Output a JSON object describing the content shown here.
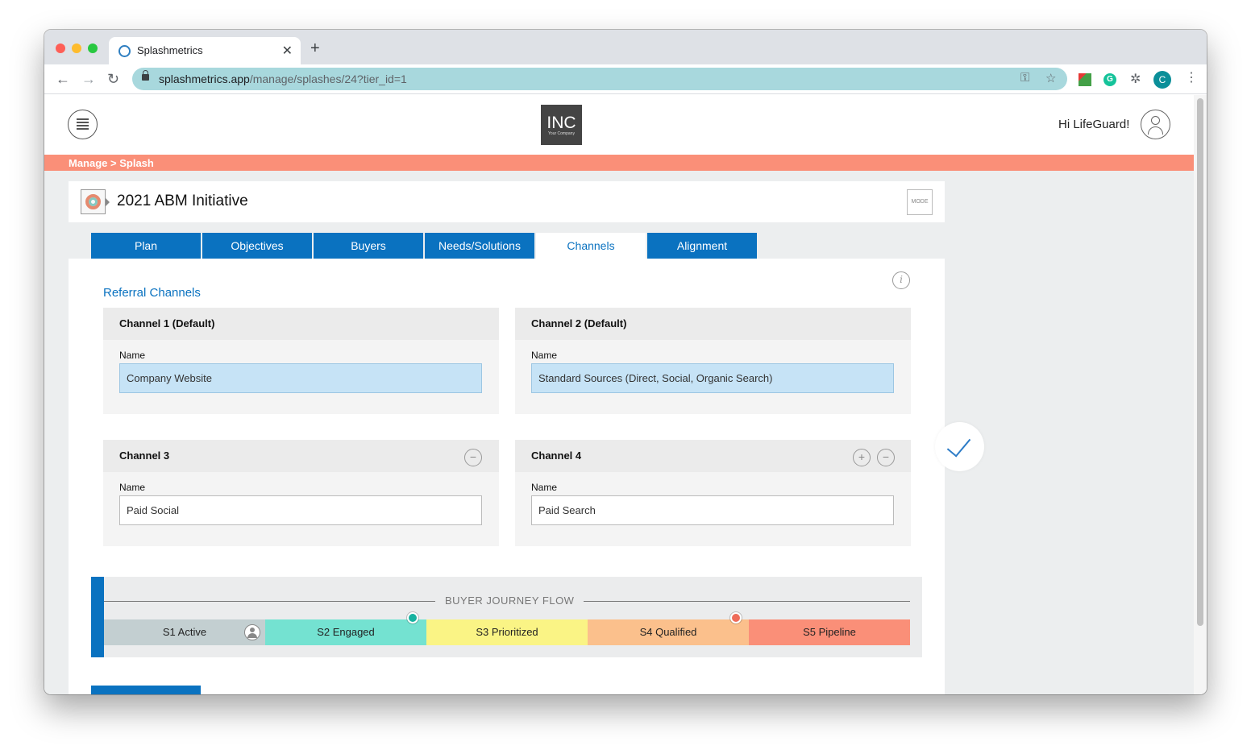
{
  "browser": {
    "tab_title": "Splashmetrics",
    "tab_close": "✕",
    "new_tab": "+",
    "url_domain": "splashmetrics.app",
    "url_path": "/manage/splashes/24?tier_id=1",
    "profile_initial": "C"
  },
  "header": {
    "logo_main": "INC",
    "logo_sub": "Your Company",
    "greeting": "Hi LifeGuard!"
  },
  "breadcrumb": "Manage > Splash",
  "initiative": {
    "title": "2021 ABM Initiative",
    "mode_label": "MODE"
  },
  "tabs": [
    {
      "label": "Plan",
      "active": false
    },
    {
      "label": "Objectives",
      "active": false
    },
    {
      "label": "Buyers",
      "active": false
    },
    {
      "label": "Needs/Solutions",
      "active": false
    },
    {
      "label": "Channels",
      "active": true
    },
    {
      "label": "Alignment",
      "active": false
    }
  ],
  "section": {
    "title": "Referral Channels",
    "info_icon": "i"
  },
  "channels": [
    {
      "title": "Channel 1 (Default)",
      "name_label": "Name",
      "value": "Company Website"
    },
    {
      "title": "Channel 2 (Default)",
      "name_label": "Name",
      "value": "Standard Sources (Direct, Social, Organic Search)"
    },
    {
      "title": "Channel 3",
      "name_label": "Name",
      "value": "Paid Social"
    },
    {
      "title": "Channel 4",
      "name_label": "Name",
      "value": "Paid Search"
    }
  ],
  "buttons": {
    "add": "+",
    "remove": "−"
  },
  "journey": {
    "title": "BUYER JOURNEY FLOW",
    "stages": [
      {
        "label": "S1 Active",
        "color": "#c3cfd1"
      },
      {
        "label": "S2 Engaged",
        "color": "#74e2d1"
      },
      {
        "label": "S3 Prioritized",
        "color": "#faf485"
      },
      {
        "label": "S4 Qualified",
        "color": "#fbc08c"
      },
      {
        "label": "S5 Pipeline",
        "color": "#fa8f78"
      }
    ]
  },
  "colors": {
    "accent_blue": "#0a72c0",
    "breadcrumb_bar": "#fa8f78",
    "omnibox": "#a8d8dd"
  }
}
